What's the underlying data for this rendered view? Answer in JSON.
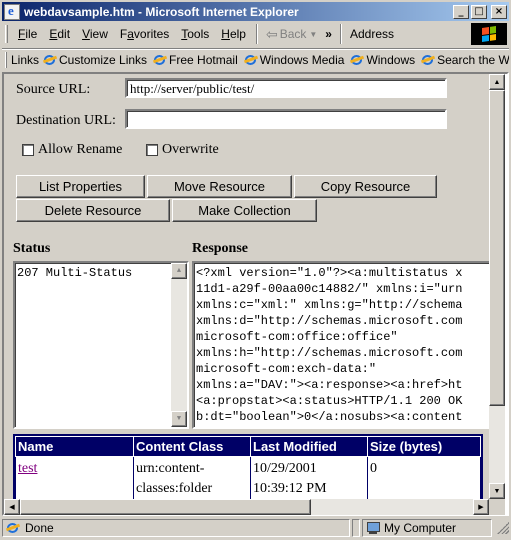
{
  "window": {
    "title": "webdavsample.htm - Microsoft Internet Explorer",
    "minimize": "_",
    "maximize": "□",
    "close": "×"
  },
  "menubar": {
    "items": [
      {
        "pre": "",
        "key": "F",
        "post": "ile"
      },
      {
        "pre": "",
        "key": "E",
        "post": "dit"
      },
      {
        "pre": "",
        "key": "V",
        "post": "iew"
      },
      {
        "pre": "F",
        "key": "a",
        "post": "vorites"
      },
      {
        "pre": "",
        "key": "T",
        "post": "ools"
      },
      {
        "pre": "",
        "key": "H",
        "post": "elp"
      }
    ],
    "back_label": "Back",
    "more": "»",
    "address_label": "Address"
  },
  "links_bar": {
    "label": "Links",
    "items": [
      "Customize Links",
      "Free Hotmail",
      "Windows Media",
      "Windows",
      "Search the W"
    ]
  },
  "form": {
    "source_url_label": "Source URL:",
    "source_url_value": "http://server/public/test/",
    "destination_url_label": "Destination URL:",
    "destination_url_value": "",
    "allow_rename_label": "Allow Rename",
    "allow_rename_checked": false,
    "overwrite_label": "Overwrite",
    "overwrite_checked": false
  },
  "buttons": {
    "list_properties": "List Properties",
    "move_resource": "Move Resource",
    "copy_resource": "Copy Resource",
    "delete_resource": "Delete Resource",
    "make_collection": "Make Collection"
  },
  "status": {
    "heading": "Status",
    "text": "207 Multi-Status"
  },
  "response": {
    "heading": "Response",
    "text": "<?xml version=\"1.0\"?><a:multistatus x\n11d1-a29f-00aa00c14882/\" xmlns:i=\"urn\nxmlns:c=\"xml:\" xmlns:g=\"http://schema\nxmlns:d=\"http://schemas.microsoft.com\nmicrosoft-com:office:office\"\nxmlns:h=\"http://schemas.microsoft.com\nmicrosoft-com:exch-data:\"\nxmlns:a=\"DAV:\"><a:response><a:href>ht\n<a:propstat><a:status>HTTP/1.1 200 OK\nb:dt=\"boolean\">0</a:nosubs><a:content"
  },
  "results_table": {
    "headers": [
      "Name",
      "Content Class",
      "Last Modified",
      "Size (bytes)"
    ],
    "rows": [
      {
        "name": "test",
        "content_class": "urn:content-classes:folder",
        "last_modified": "10/29/2001 10:39:12 PM",
        "size": "0"
      }
    ]
  },
  "statusbar": {
    "text": "Done",
    "zone": "My Computer"
  },
  "colors": {
    "table_header_bg": "#000066",
    "visited_link": "#800080",
    "titlebar_start": "#0a246a",
    "titlebar_end": "#a6caf0"
  }
}
